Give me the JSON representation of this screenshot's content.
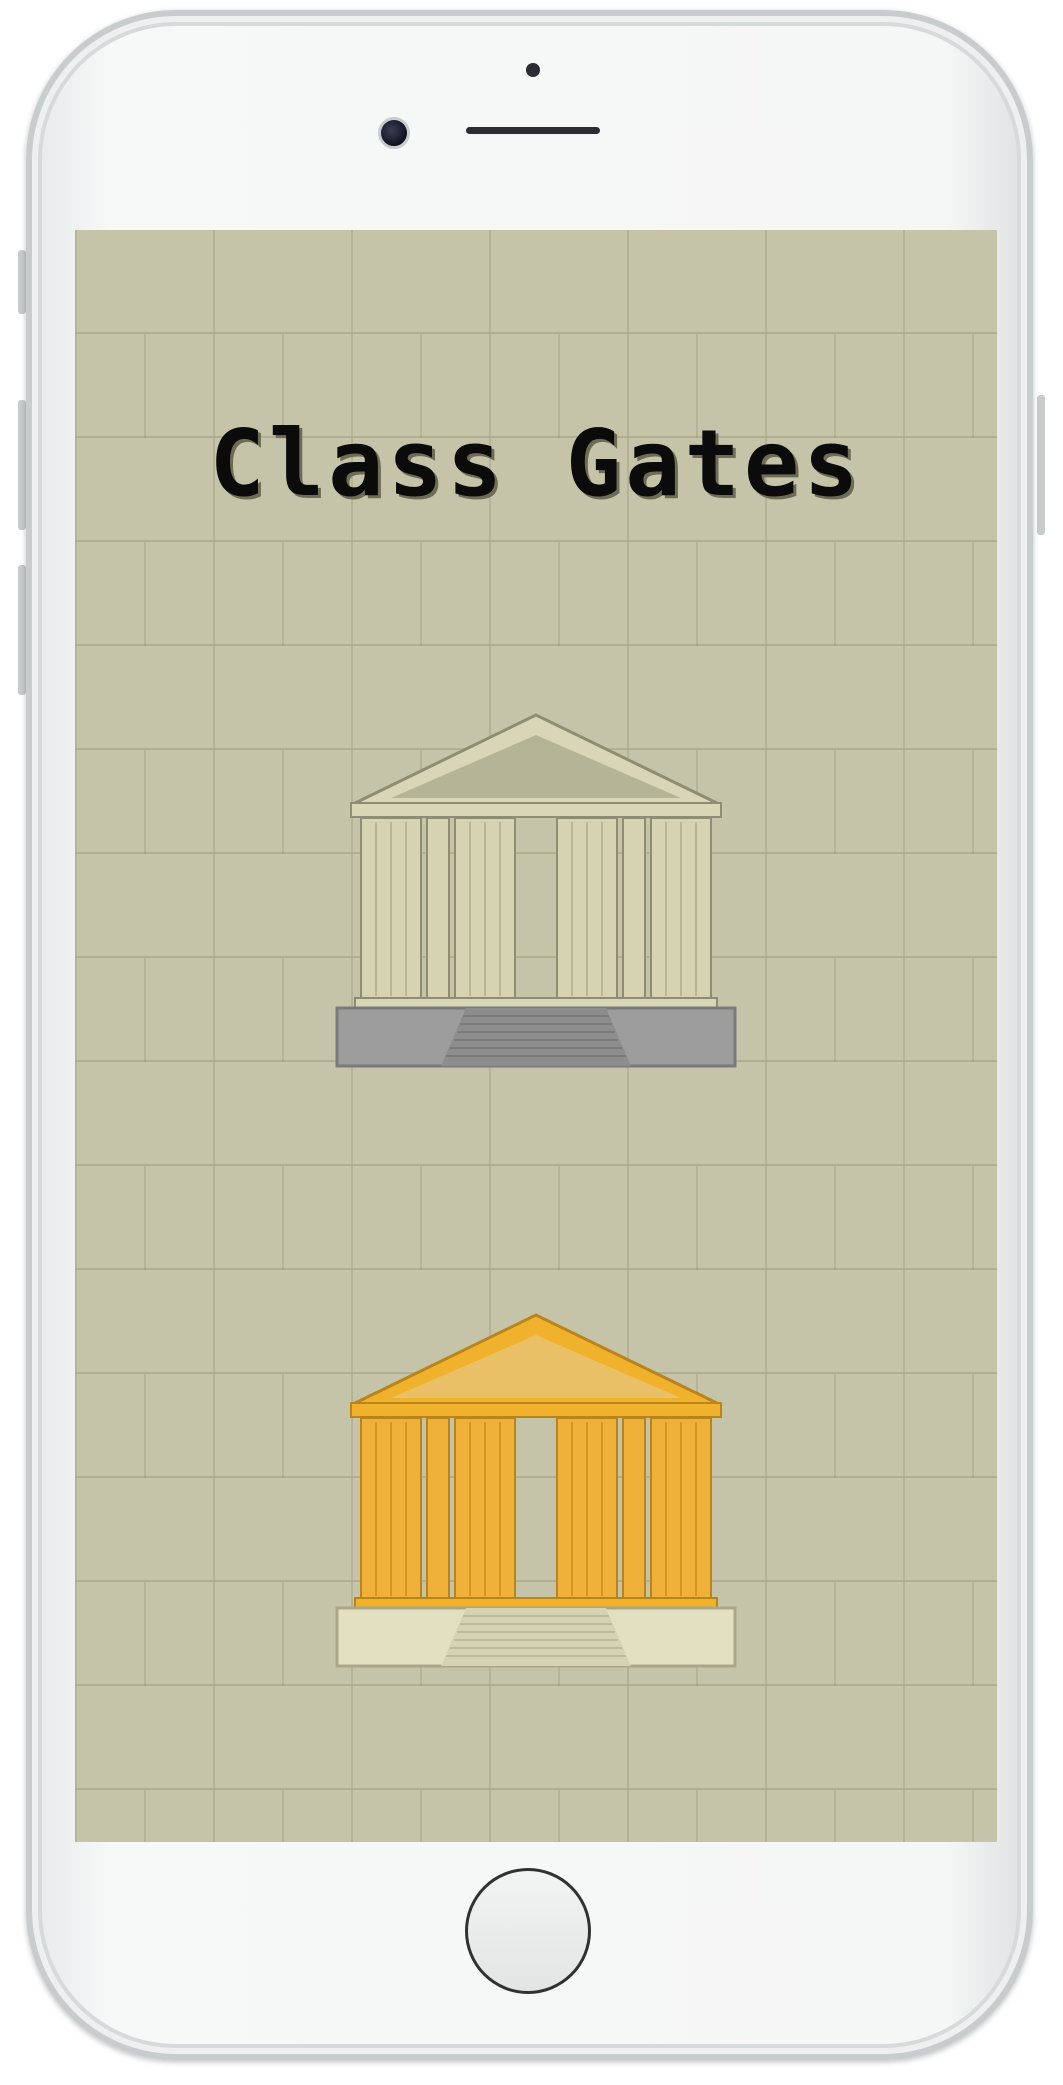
{
  "app": {
    "title": "Class Gates"
  },
  "gates": [
    {
      "name": "gray-gate",
      "state": "locked",
      "colors": {
        "roof": "#d9d6b8",
        "pediment": "#b6b497",
        "columns": "#d6d3b3",
        "base": "#9d9d9d"
      }
    },
    {
      "name": "gold-gate",
      "state": "unlocked",
      "colors": {
        "roof": "#f0b12d",
        "pediment": "#e9c065",
        "columns": "#efb13a",
        "base": "#e3e0c2"
      }
    }
  ],
  "colors": {
    "screen_background": "#c6c4a8",
    "title_text": "#0b0b0b",
    "phone_frame": "#f5f6f6"
  }
}
